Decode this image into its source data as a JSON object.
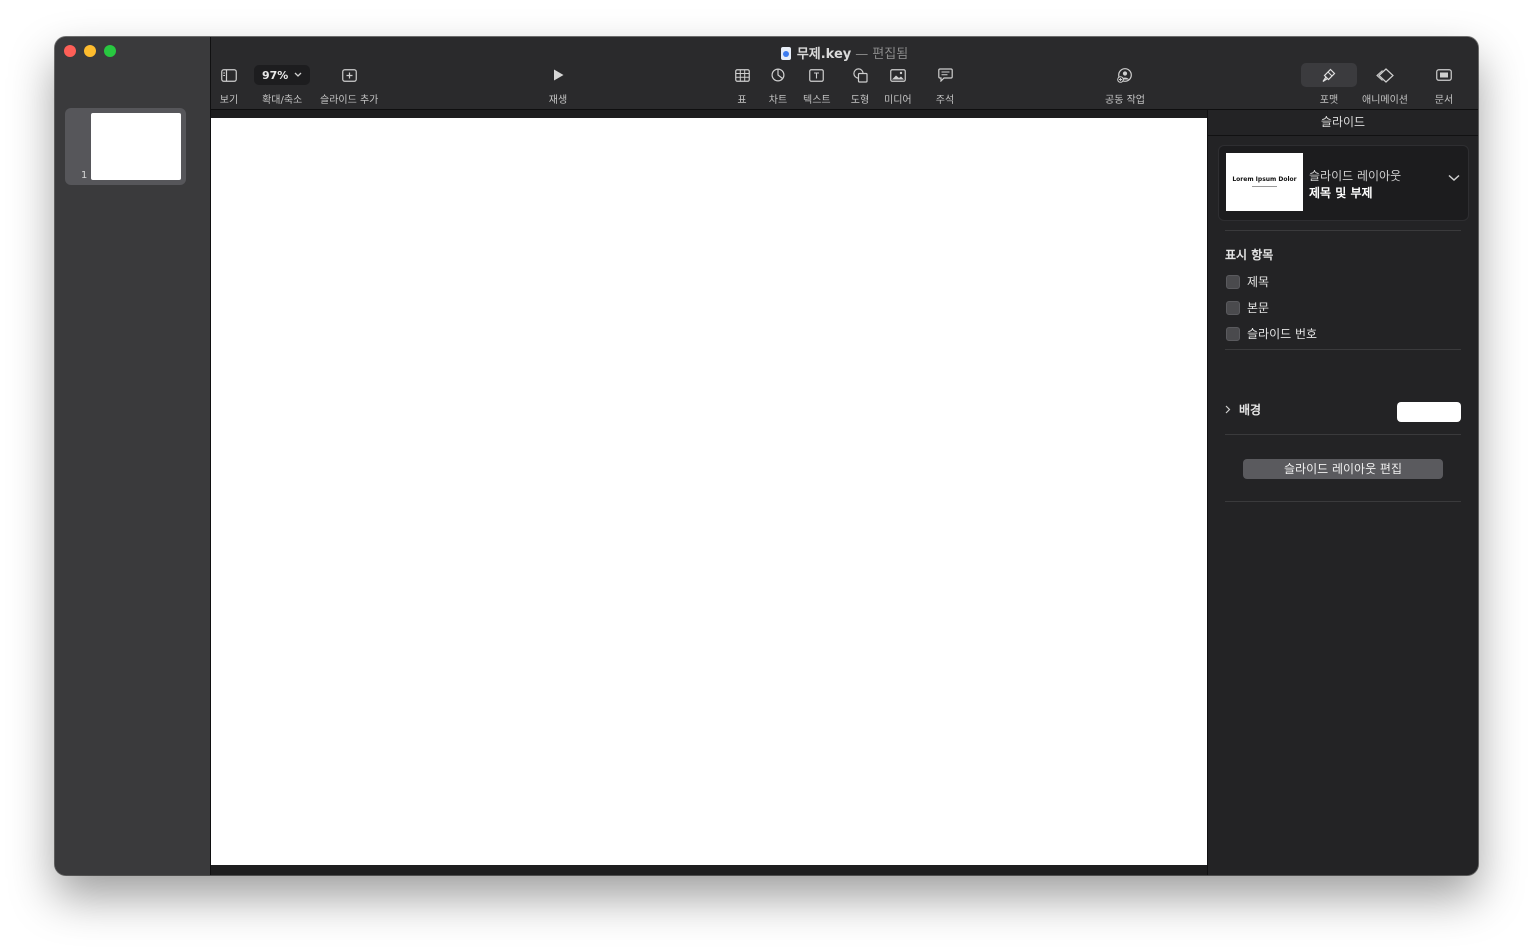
{
  "window": {
    "title_name": "무제.key",
    "title_sep": "—",
    "title_status": "편집됨"
  },
  "toolbar": {
    "view_label": "보기",
    "zoom_value": "97%",
    "zoom_label": "확대/축소",
    "add_slide_label": "슬라이드 추가",
    "play_label": "재생",
    "table_label": "표",
    "chart_label": "차트",
    "text_label": "텍스트",
    "shape_label": "도형",
    "media_label": "미디어",
    "comment_label": "주석",
    "collaborate_label": "공동 작업",
    "format_label": "포맷",
    "animate_label": "애니메이션",
    "document_label": "문서"
  },
  "navigator": {
    "slides": [
      {
        "number": "1"
      }
    ]
  },
  "inspector": {
    "title": "슬라이드",
    "layout_label": "슬라이드 레이아웃",
    "layout_value": "제목 및 부제",
    "layout_thumb_text": "Lorem Ipsum Dolor",
    "appearance_label": "표시 항목",
    "checkboxes": [
      {
        "label": "제목",
        "checked": false
      },
      {
        "label": "본문",
        "checked": false
      },
      {
        "label": "슬라이드 번호",
        "checked": false
      }
    ],
    "background_label": "배경",
    "background_color": "#ffffff",
    "edit_layout_button": "슬라이드 레이아웃 편집"
  }
}
